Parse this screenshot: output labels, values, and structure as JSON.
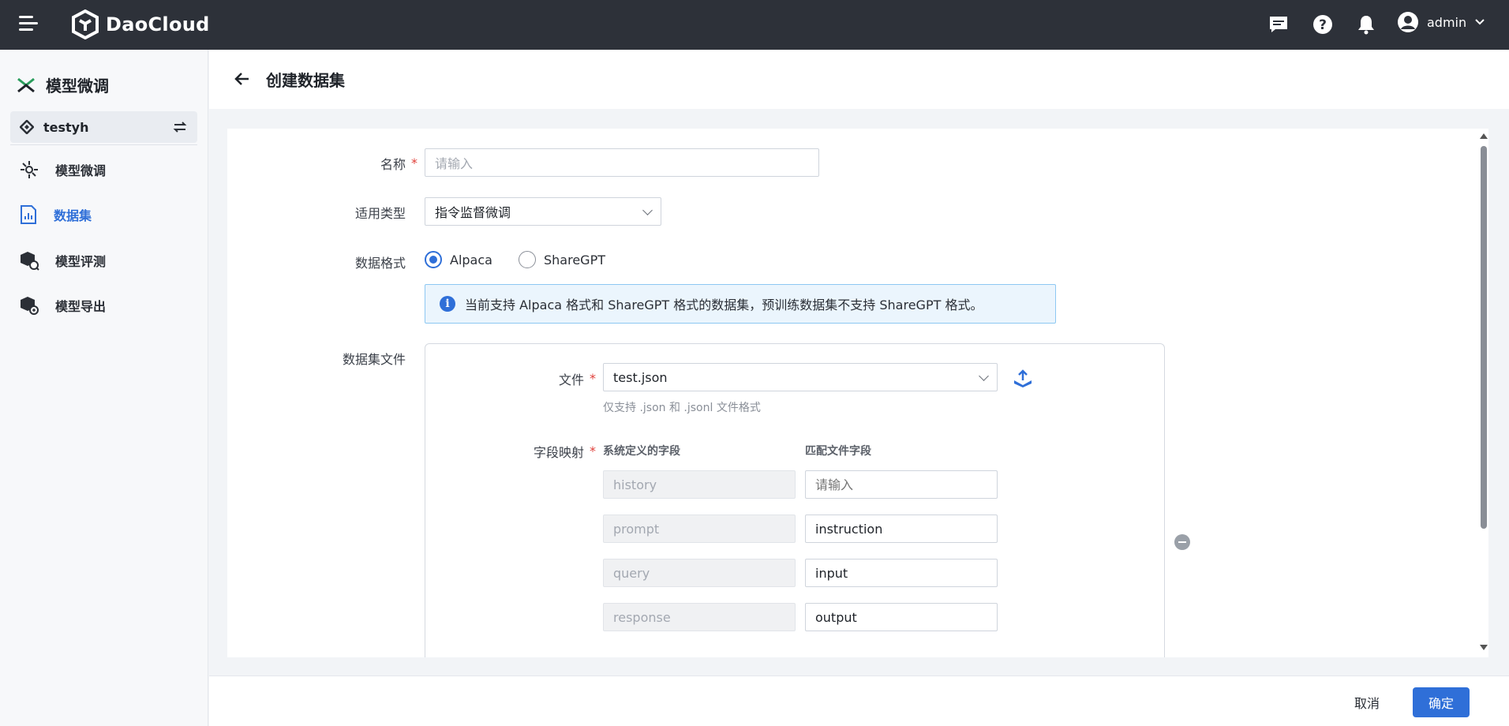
{
  "topbar": {
    "brand": "DaoCloud",
    "username": "admin",
    "icons": [
      "menu-icon",
      "message-icon",
      "help-icon",
      "bell-icon",
      "user-avatar-icon",
      "chevron-down-icon"
    ]
  },
  "sidebar": {
    "title": "模型微调",
    "workspace": "testyh",
    "items": [
      {
        "label": "模型微调",
        "icon": "finetune-icon",
        "active": false
      },
      {
        "label": "数据集",
        "icon": "dataset-icon",
        "active": true
      },
      {
        "label": "模型评测",
        "icon": "evaluate-icon",
        "active": false
      },
      {
        "label": "模型导出",
        "icon": "export-icon",
        "active": false
      }
    ]
  },
  "header": {
    "title": "创建数据集"
  },
  "form": {
    "name": {
      "label": "名称",
      "placeholder": "请输入",
      "value": ""
    },
    "type": {
      "label": "适用类型",
      "value": "指令监督微调"
    },
    "format": {
      "label": "数据格式",
      "options": [
        {
          "label": "Alpaca",
          "checked": true
        },
        {
          "label": "ShareGPT",
          "checked": false
        }
      ],
      "notice": "当前支持 Alpaca 格式和 ShareGPT 格式的数据集，预训练数据集不支持 ShareGPT 格式。"
    },
    "dataset_file": {
      "label": "数据集文件",
      "file_label": "文件",
      "file_value": "test.json",
      "file_hint": "仅支持 .json 和 .jsonl 文件格式",
      "mapping_label": "字段映射",
      "col_system": "系统定义的字段",
      "col_match": "匹配文件字段",
      "mappings": [
        {
          "system": "history",
          "match": "",
          "match_placeholder": "请输入"
        },
        {
          "system": "prompt",
          "match": "instruction",
          "match_placeholder": "请输入"
        },
        {
          "system": "query",
          "match": "input",
          "match_placeholder": "请输入"
        },
        {
          "system": "response",
          "match": "output",
          "match_placeholder": "请输入"
        },
        {
          "system": "",
          "match": "",
          "match_placeholder": "请输入"
        }
      ]
    }
  },
  "footer": {
    "cancel": "取消",
    "confirm": "确定"
  },
  "colors": {
    "topbar": "#2d3139",
    "primary": "#2f6fd8",
    "required": "#e0413b",
    "alert_bg": "#ebf5fd"
  }
}
